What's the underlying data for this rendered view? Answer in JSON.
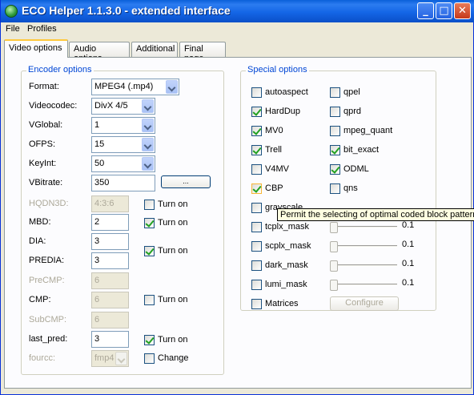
{
  "window": {
    "title": "ECO Helper 1.1.3.0 - extended interface"
  },
  "menu": [
    "File",
    "Profiles"
  ],
  "tabs": [
    "Video options",
    "Audio options",
    "Additional",
    "Final page"
  ],
  "encoder": {
    "title": "Encoder options",
    "format": {
      "label": "Format:",
      "value": "MPEG4 (.mp4)"
    },
    "videocodec": {
      "label": "Videocodec:",
      "value": "DivX 4/5"
    },
    "vglobal": {
      "label": "VGlobal:",
      "value": "1"
    },
    "ofps": {
      "label": "OFPS:",
      "value": "15"
    },
    "keyint": {
      "label": "KeyInt:",
      "value": "50"
    },
    "vbitrate": {
      "label": "VBitrate:",
      "value": "350",
      "button": "..."
    },
    "hqdn3d": {
      "label": "HQDN3D:",
      "value": "4:3:6",
      "check": "Turn on",
      "checked": false
    },
    "mbd": {
      "label": "MBD:",
      "value": "2",
      "check": "Turn on",
      "checked": true
    },
    "dia": {
      "label": "DIA:",
      "value": "3"
    },
    "predia": {
      "label": "PREDIA:",
      "value": "3"
    },
    "dia_predia_check": {
      "label": "Turn on",
      "checked": true
    },
    "precmp": {
      "label": "PreCMP:",
      "value": "6"
    },
    "cmp": {
      "label": "CMP:",
      "value": "6"
    },
    "cmp_check": {
      "label": "Turn on",
      "checked": false
    },
    "subcmp": {
      "label": "SubCMP:",
      "value": "6"
    },
    "last_pred": {
      "label": "last_pred:",
      "value": "3",
      "check": "Turn on",
      "checked": true
    },
    "fourcc": {
      "label": "fourcc:",
      "value": "fmp4",
      "check": "Change",
      "checked": false
    }
  },
  "special": {
    "title": "Special options",
    "left": [
      {
        "label": "autoaspect",
        "checked": false
      },
      {
        "label": "HardDup",
        "checked": true
      },
      {
        "label": "MV0",
        "checked": true
      },
      {
        "label": "Trell",
        "checked": true
      },
      {
        "label": "V4MV",
        "checked": false
      },
      {
        "label": "CBP",
        "checked": true
      },
      {
        "label": "grayscale",
        "checked": false
      }
    ],
    "right": [
      {
        "label": "qpel",
        "checked": false
      },
      {
        "label": "qprd",
        "checked": false
      },
      {
        "label": "mpeg_quant",
        "checked": false
      },
      {
        "label": "bit_exact",
        "checked": true
      },
      {
        "label": "ODML",
        "checked": true
      },
      {
        "label": "qns",
        "checked": false
      }
    ],
    "masks": [
      {
        "label": "tcplx_mask",
        "checked": false,
        "value": "0.1"
      },
      {
        "label": "scplx_mask",
        "checked": false,
        "value": "0.1"
      },
      {
        "label": "dark_mask",
        "checked": false,
        "value": "0.1"
      },
      {
        "label": "lumi_mask",
        "checked": false,
        "value": "0.1"
      }
    ],
    "matrices": {
      "label": "Matrices",
      "checked": false,
      "button": "Configure"
    }
  },
  "tooltip": "Permit the selecting of optimal coded block pattern"
}
